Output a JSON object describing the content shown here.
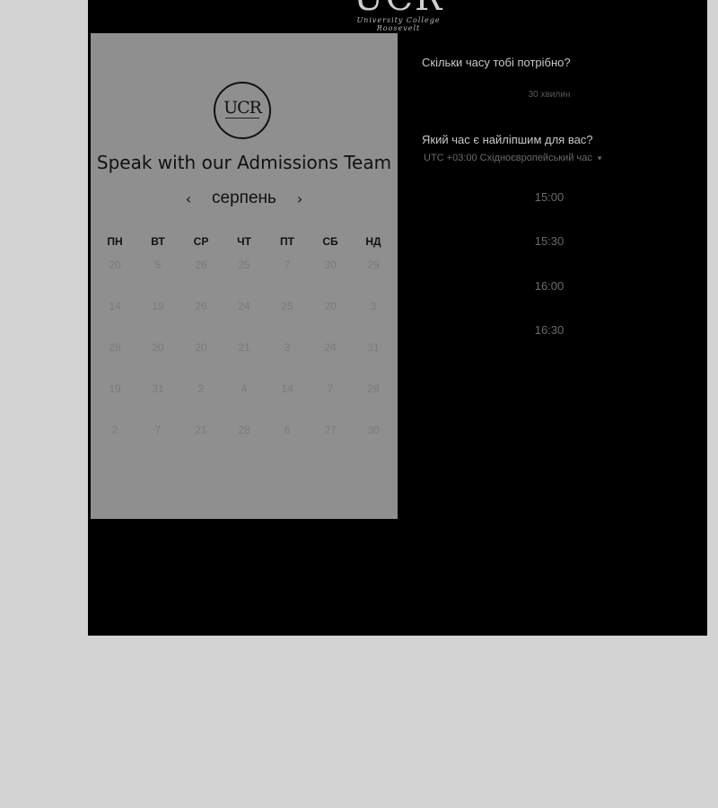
{
  "header": {
    "logo_mark": "UCR",
    "logo_sub": "University College Roosevelt"
  },
  "panel": {
    "seal_text": "UCR",
    "title": "Speak with our Admissions Team",
    "month": "серпень",
    "prev_icon": "‹",
    "next_icon": "›"
  },
  "calendar": {
    "weekdays": [
      "ПН",
      "ВТ",
      "СР",
      "ЧТ",
      "ПТ",
      "СБ",
      "НД"
    ],
    "rows": [
      [
        "20",
        "5",
        "26",
        "25",
        "7",
        "30",
        "29"
      ],
      [
        "14",
        "19",
        "26",
        "24",
        "25",
        "20",
        "3"
      ],
      [
        "28",
        "20",
        "20",
        "21",
        "3",
        "24",
        "31"
      ],
      [
        "19",
        "31",
        "2",
        "4",
        "14",
        "7",
        "28"
      ],
      [
        "2",
        "7",
        "21",
        "28",
        "6",
        "27",
        "30"
      ]
    ]
  },
  "booking": {
    "duration_question": "Скільки часу тобі потрібно?",
    "duration": "30 хвилин",
    "time_question": "Який час є найліпшим для вас?",
    "timezone": "UTC +03:00 Східноєвропейський час",
    "timezone_caret": "▾",
    "slots": [
      "15:00",
      "15:30",
      "16:00",
      "16:30"
    ]
  }
}
